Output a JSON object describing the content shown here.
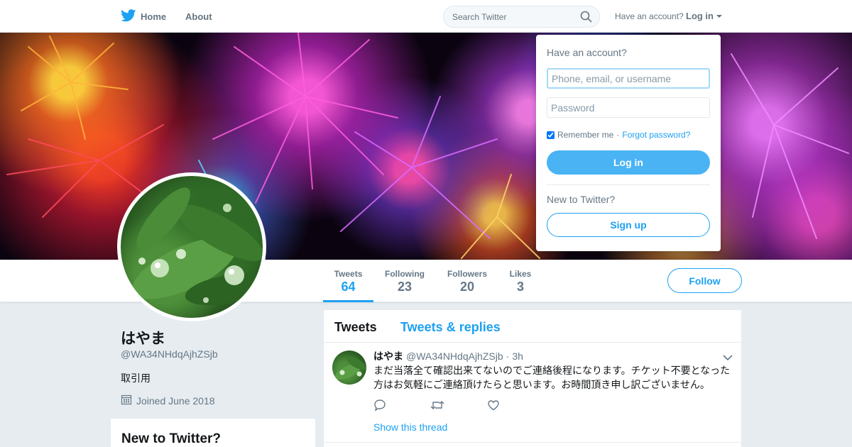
{
  "nav": {
    "home_label": "Home",
    "about_label": "About",
    "search_placeholder": "Search Twitter",
    "account_prompt": "Have an account?",
    "login_label": "Log in",
    "brand_color": "#1da1f2"
  },
  "profile": {
    "name": "はやま",
    "handle": "@WA34NHdqAjhZSjb",
    "bio": "取引用",
    "joined": "Joined June 2018"
  },
  "stats": [
    {
      "label": "Tweets",
      "value": "64",
      "active": true
    },
    {
      "label": "Following",
      "value": "23",
      "active": false
    },
    {
      "label": "Followers",
      "value": "20",
      "active": false
    },
    {
      "label": "Likes",
      "value": "3",
      "active": false
    }
  ],
  "follow_label": "Follow",
  "sidebar": {
    "new_to_twitter": "New to Twitter?"
  },
  "timeline": {
    "tabs": [
      "Tweets",
      "Tweets & replies"
    ],
    "tweet": {
      "name": "はやま",
      "handle": "@WA34NHdqAjhZSjb",
      "separator": "·",
      "time": "3h",
      "text": "まだ当落全て確認出来てないのでご連絡後程になります。チケット不要となった方はお気軽にご連絡頂けたらと思います。お時間頂き申し訳ございません。",
      "thread_link": "Show this thread"
    }
  },
  "login_dropdown": {
    "heading": "Have an account?",
    "username_placeholder": "Phone, email, or username",
    "password_placeholder": "Password",
    "remember_label": "Remember me",
    "separator": "·",
    "forgot_label": "Forgot password?",
    "login_button": "Log in",
    "new_heading": "New to Twitter?",
    "signup_button": "Sign up"
  }
}
